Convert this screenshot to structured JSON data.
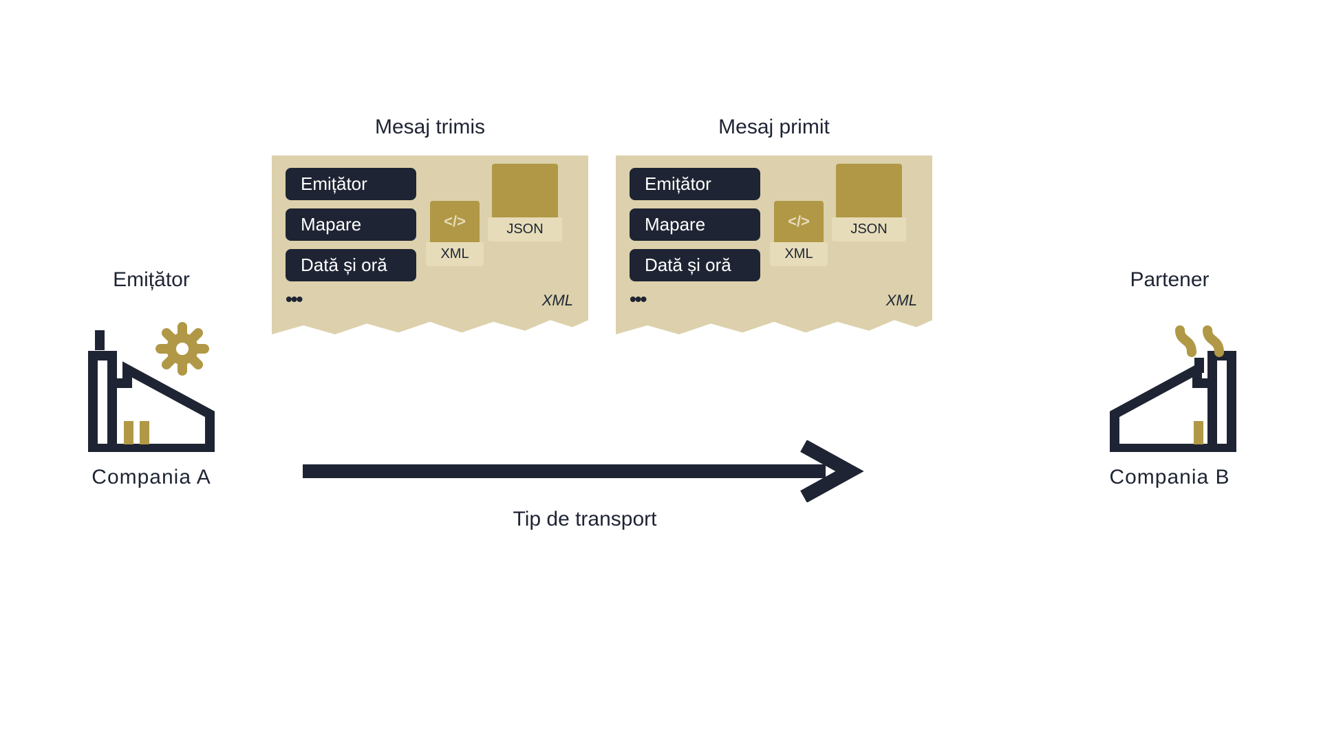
{
  "left": {
    "title": "Emițător",
    "caption": "Compania  A"
  },
  "right": {
    "title": "Partener",
    "caption": "Compania  B"
  },
  "arrow": {
    "label": "Tip de transport"
  },
  "card_sent": {
    "title": "Mesaj trimis",
    "pills": {
      "p1": "Emițător",
      "p2": "Mapare",
      "p3": "Dată și oră"
    },
    "xml_code": "</>",
    "xml_label": "XML",
    "json_label": "JSON",
    "format_hint": "XML"
  },
  "card_recv": {
    "title": "Mesaj primit",
    "pills": {
      "p1": "Emițător",
      "p2": "Mapare",
      "p3": "Dată și oră"
    },
    "xml_code": "</>",
    "xml_label": "XML",
    "json_label": "JSON",
    "format_hint": "XML"
  }
}
